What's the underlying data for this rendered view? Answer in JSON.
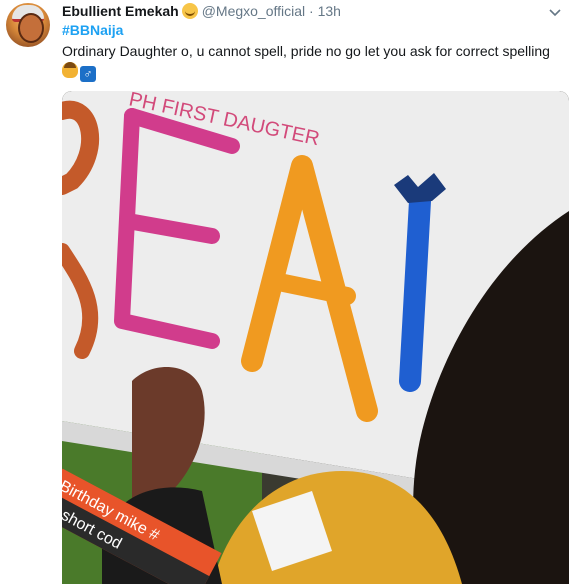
{
  "tweet": {
    "display_name": "Ebullient Emekah",
    "handle": "@Megxo_official",
    "separator": "·",
    "time": "13h",
    "hashtag": "#BBNaija",
    "text": "Ordinary Daughter o, u cannot spell, pride no go let you ask for correct spelling",
    "emojis": [
      "woman-emoji",
      "male-sign-emoji"
    ],
    "male_symbol": "♂",
    "menu_icon": "chevron-down-icon",
    "name_badge_icon": "smiling-face-emoji"
  },
  "photo": {
    "board_small_text": "PH FIRST DAUGTER",
    "big_letters": [
      "R",
      "E",
      "A",
      "I"
    ],
    "banner_line1": "Birthday mike #",
    "banner_line2": "S short cod",
    "colors": {
      "board": "#efefef",
      "r_color": "#c45a2a",
      "e_color": "#d13c8c",
      "a_color": "#f09a20",
      "i_color": "#1f5fd1",
      "banner": "#e8542a",
      "grass": "#4a7a2a"
    }
  }
}
